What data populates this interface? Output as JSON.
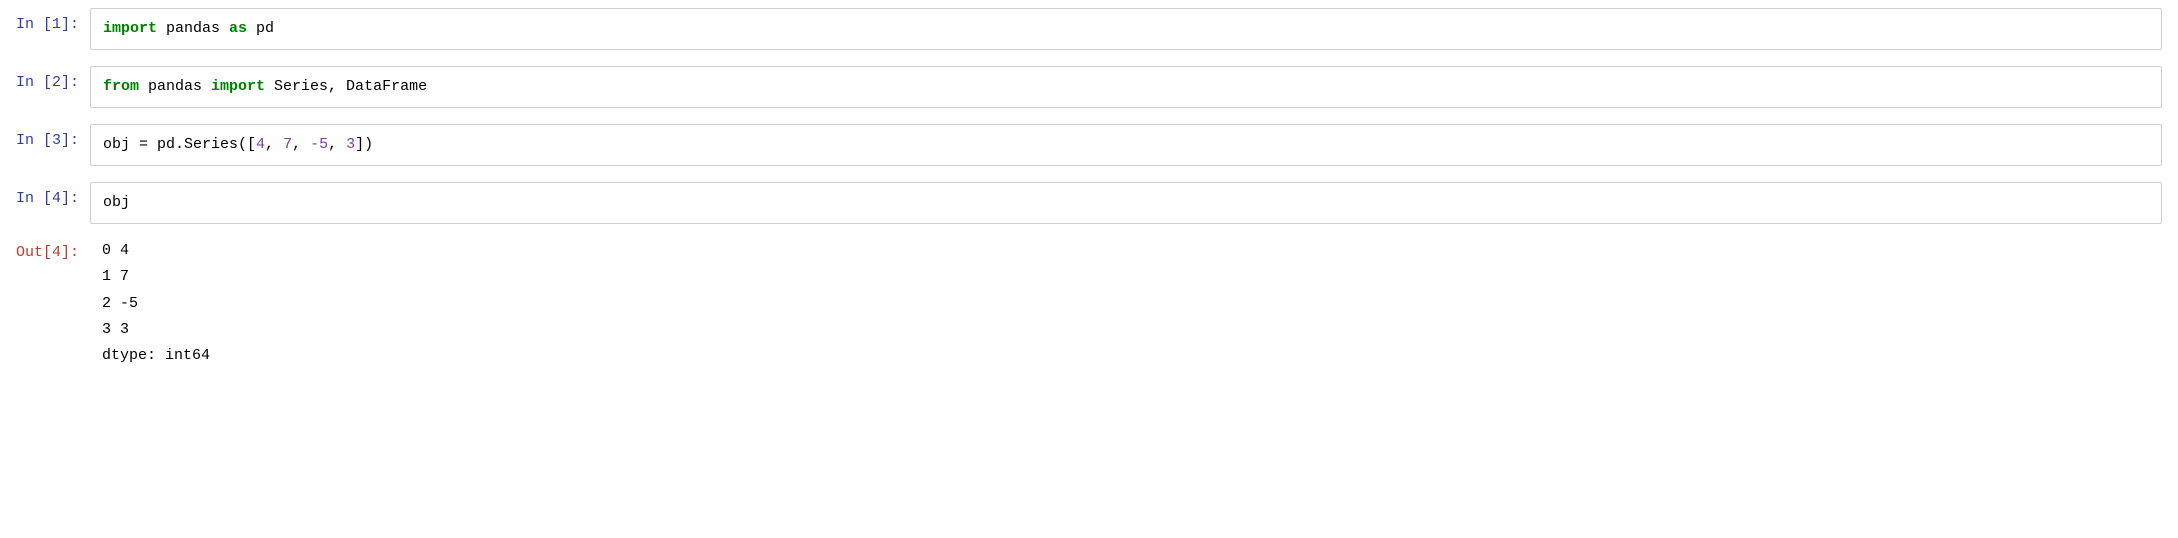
{
  "cells": [
    {
      "id": "cell1",
      "label_in": "In [1]:",
      "label_out": null,
      "type": "input",
      "code_parts": [
        {
          "text": "import",
          "style": "kw-green"
        },
        {
          "text": " pandas ",
          "style": "code-black"
        },
        {
          "text": "as",
          "style": "kw-green"
        },
        {
          "text": " pd",
          "style": "code-black"
        }
      ]
    },
    {
      "id": "cell2",
      "label_in": "In [2]:",
      "label_out": null,
      "type": "input",
      "code_parts": [
        {
          "text": "from",
          "style": "kw-green"
        },
        {
          "text": " pandas ",
          "style": "code-black"
        },
        {
          "text": "import",
          "style": "kw-green"
        },
        {
          "text": " Series, DataFrame",
          "style": "code-black"
        }
      ]
    },
    {
      "id": "cell3",
      "label_in": "In [3]:",
      "label_out": null,
      "type": "input",
      "code_parts": [
        {
          "text": "obj = pd.Series([",
          "style": "code-black"
        },
        {
          "text": "4",
          "style": "num-purple"
        },
        {
          "text": ", ",
          "style": "code-black"
        },
        {
          "text": "7",
          "style": "num-purple"
        },
        {
          "text": ", ",
          "style": "code-black"
        },
        {
          "text": "-5",
          "style": "num-purple"
        },
        {
          "text": ", ",
          "style": "code-black"
        },
        {
          "text": "3",
          "style": "num-purple"
        },
        {
          "text": "])",
          "style": "code-black"
        }
      ]
    },
    {
      "id": "cell4",
      "label_in": "In [4]:",
      "label_out": "Out[4]:",
      "type": "input_output",
      "code_parts": [
        {
          "text": "obj",
          "style": "code-black"
        }
      ],
      "output_rows": [
        {
          "index": "0",
          "value": "    4"
        },
        {
          "index": "1",
          "value": "    7"
        },
        {
          "index": "2",
          "value": "   -5"
        },
        {
          "index": "3",
          "value": "    3"
        }
      ],
      "dtype_line": "dtype: int64"
    }
  ],
  "labels": {
    "in1": "In [1]:",
    "in2": "In [2]:",
    "in3": "In [3]:",
    "in4": "In [4]:",
    "out4": "Out[4]:"
  }
}
